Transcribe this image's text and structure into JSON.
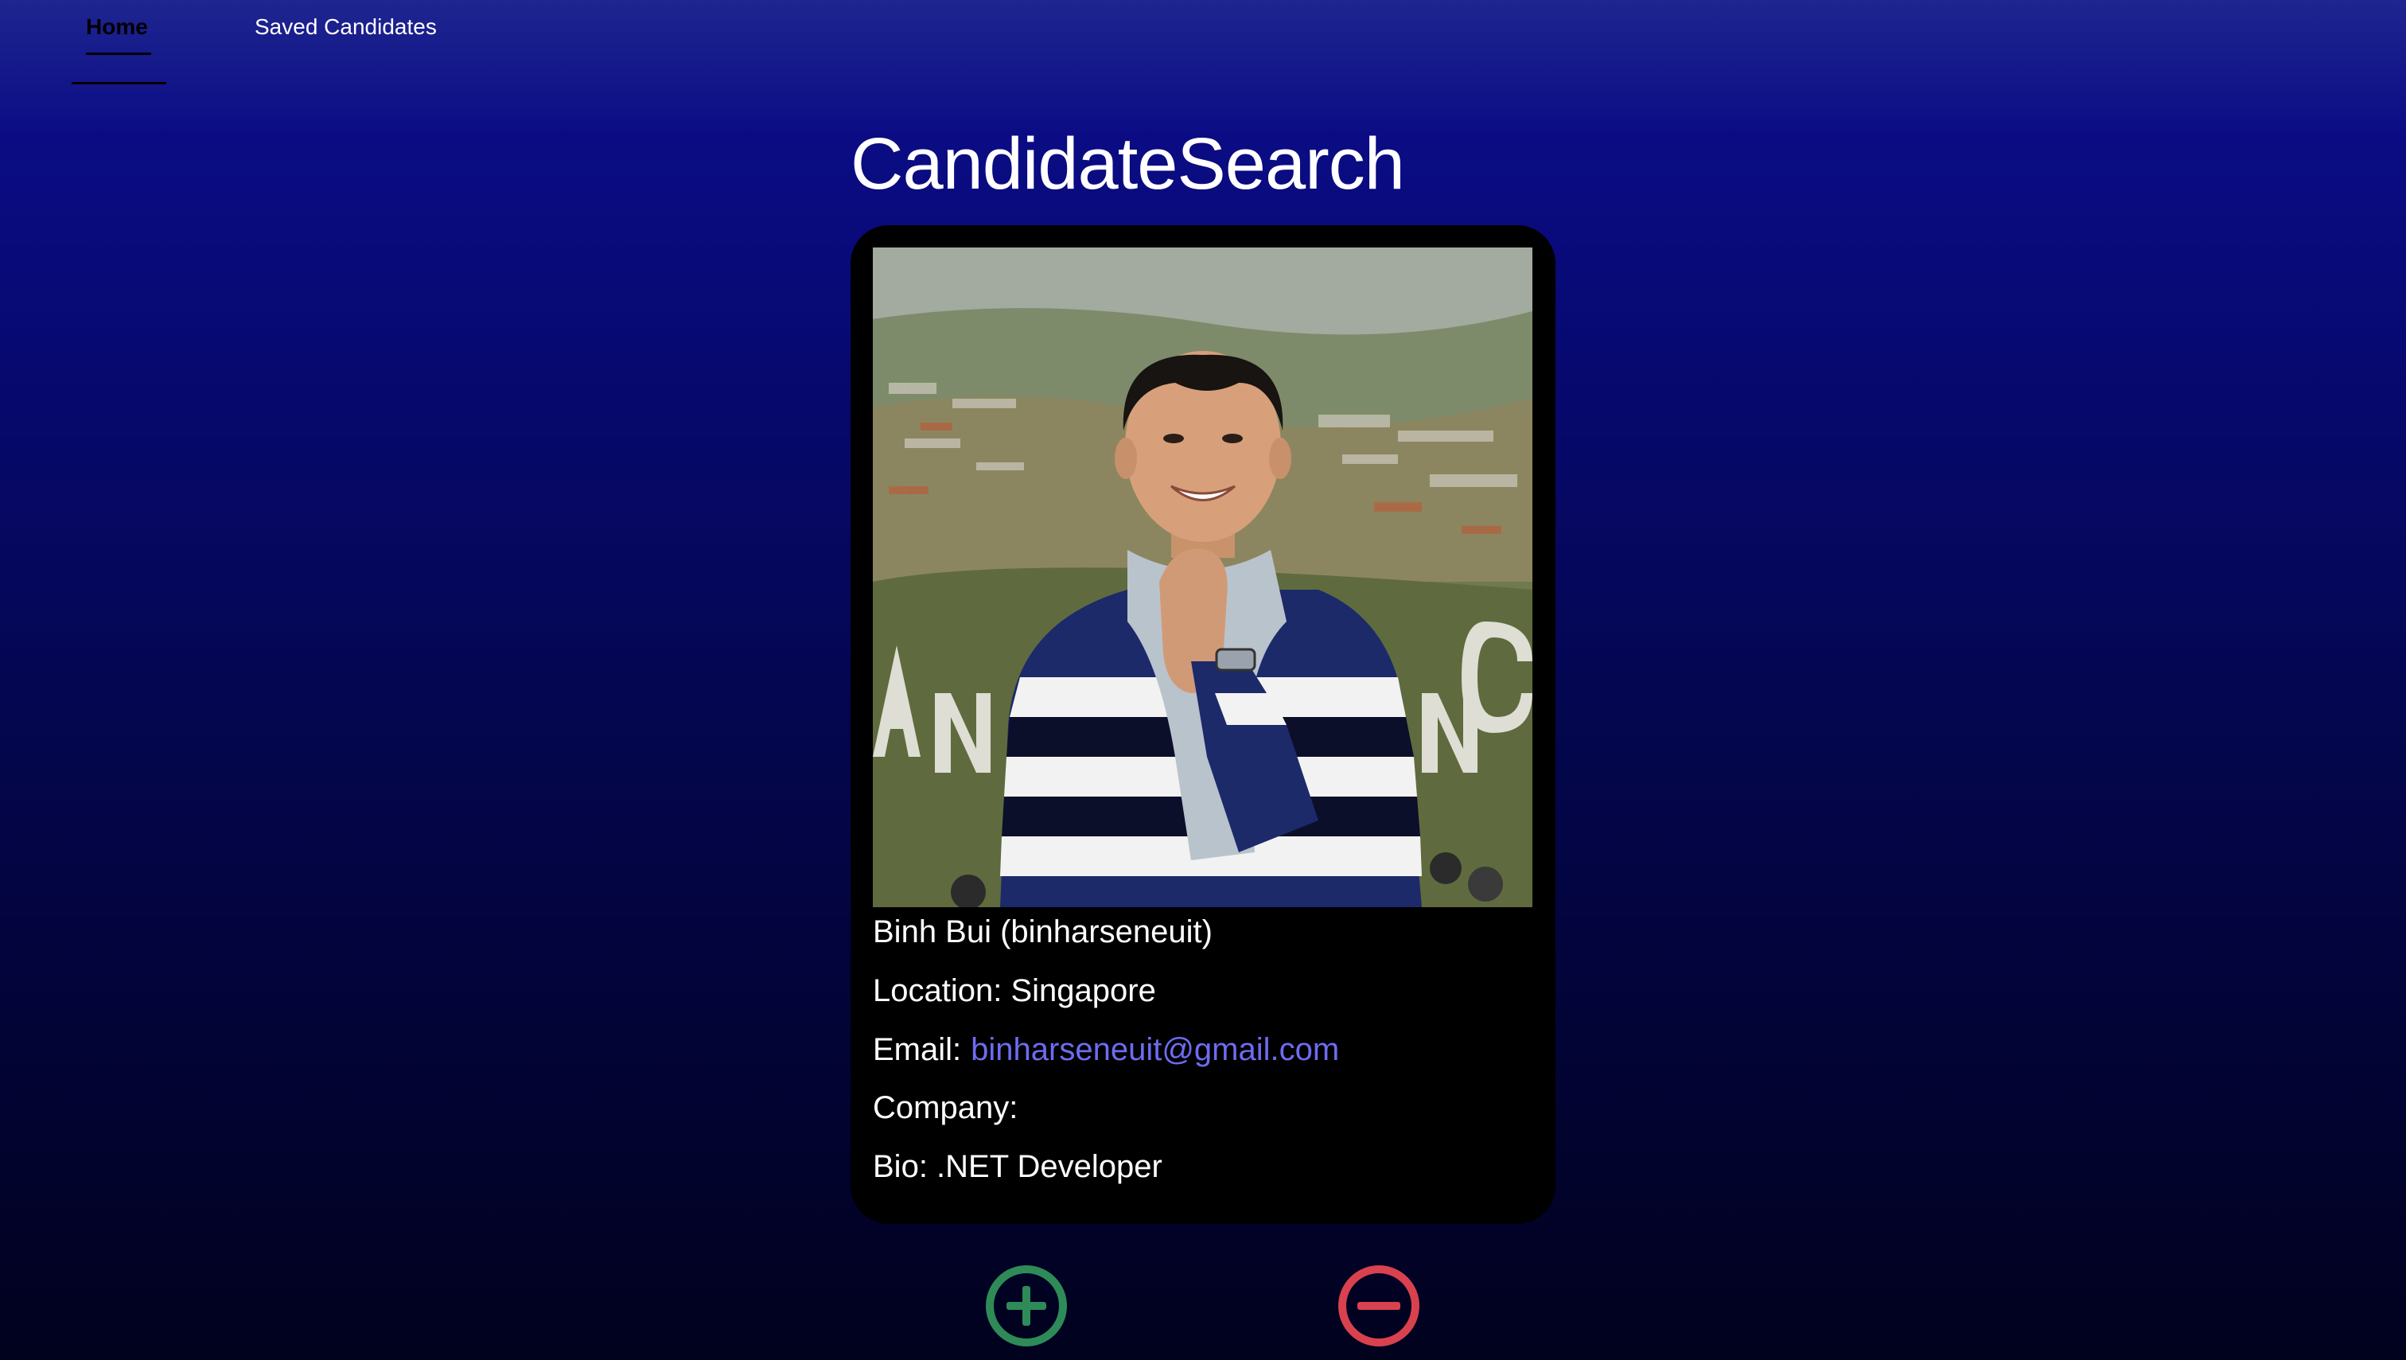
{
  "nav": {
    "items": [
      {
        "label": "Home",
        "active": true
      },
      {
        "label": "Saved Candidates",
        "active": false
      }
    ]
  },
  "page": {
    "title": "CandidateSearch"
  },
  "candidate": {
    "name_line": "Binh Bui (binharseneuit)",
    "location_line": "Location: Singapore",
    "email_label": "Email:",
    "email": "binharseneuit@gmail.com",
    "company_line": "Company:",
    "bio_line": "Bio: .NET Developer",
    "avatar_icon": "candidate-avatar-photo"
  },
  "actions": {
    "add_icon": "plus-circle-icon",
    "reject_icon": "minus-circle-icon"
  },
  "colors": {
    "link": "#6d6cf0",
    "add": "#2e8b57",
    "reject": "#d9414f",
    "card": "#000000"
  }
}
